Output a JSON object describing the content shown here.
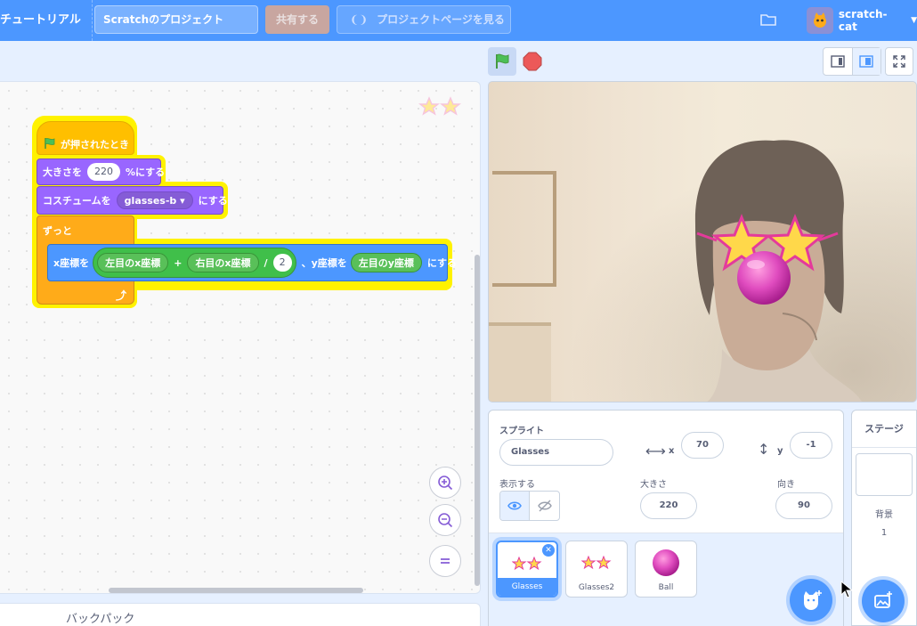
{
  "menubar": {
    "tutorials": "チュートリアル",
    "project_title": "Scratchのプロジェクト",
    "share": "共有する",
    "project_page": "プロジェクトページを見る",
    "username": "scratch-cat"
  },
  "code": {
    "event_label": "が押されたとき",
    "size_prefix": "大きさを",
    "size_value": "220",
    "size_suffix": "%にする",
    "costume_prefix": "コスチュームを",
    "costume_value": "glasses-b ▾",
    "costume_suffix": "にする",
    "forever": "ずっと",
    "setxy_x_prefix": "x座標を",
    "left_eye_x": "左目のx座標",
    "plus": "+",
    "right_eye_x": "右目のx座標",
    "divide": "/",
    "divisor": "2",
    "setxy_y_prefix": "、y座標を",
    "left_eye_y": "左目のy座標",
    "setxy_suffix": "にする"
  },
  "backpack": {
    "label": "バックパック"
  },
  "sprite_info": {
    "sprite_label": "スプライト",
    "sprite_name": "Glasses",
    "x_label": "x",
    "x_value": "70",
    "y_label": "y",
    "y_value": "-1",
    "show_label": "表示する",
    "size_label": "大きさ",
    "size_value": "220",
    "direction_label": "向き",
    "direction_value": "90"
  },
  "sprites": [
    {
      "name": "Glasses"
    },
    {
      "name": "Glasses2"
    },
    {
      "name": "Ball"
    }
  ],
  "stage_pane": {
    "title": "ステージ",
    "backdrop_label": "背景",
    "backdrop_count": "1"
  },
  "colors": {
    "accent": "#4c97ff",
    "looks": "#9966ff",
    "control": "#ffab19",
    "operators": "#59c059",
    "highlight": "#fff200"
  }
}
